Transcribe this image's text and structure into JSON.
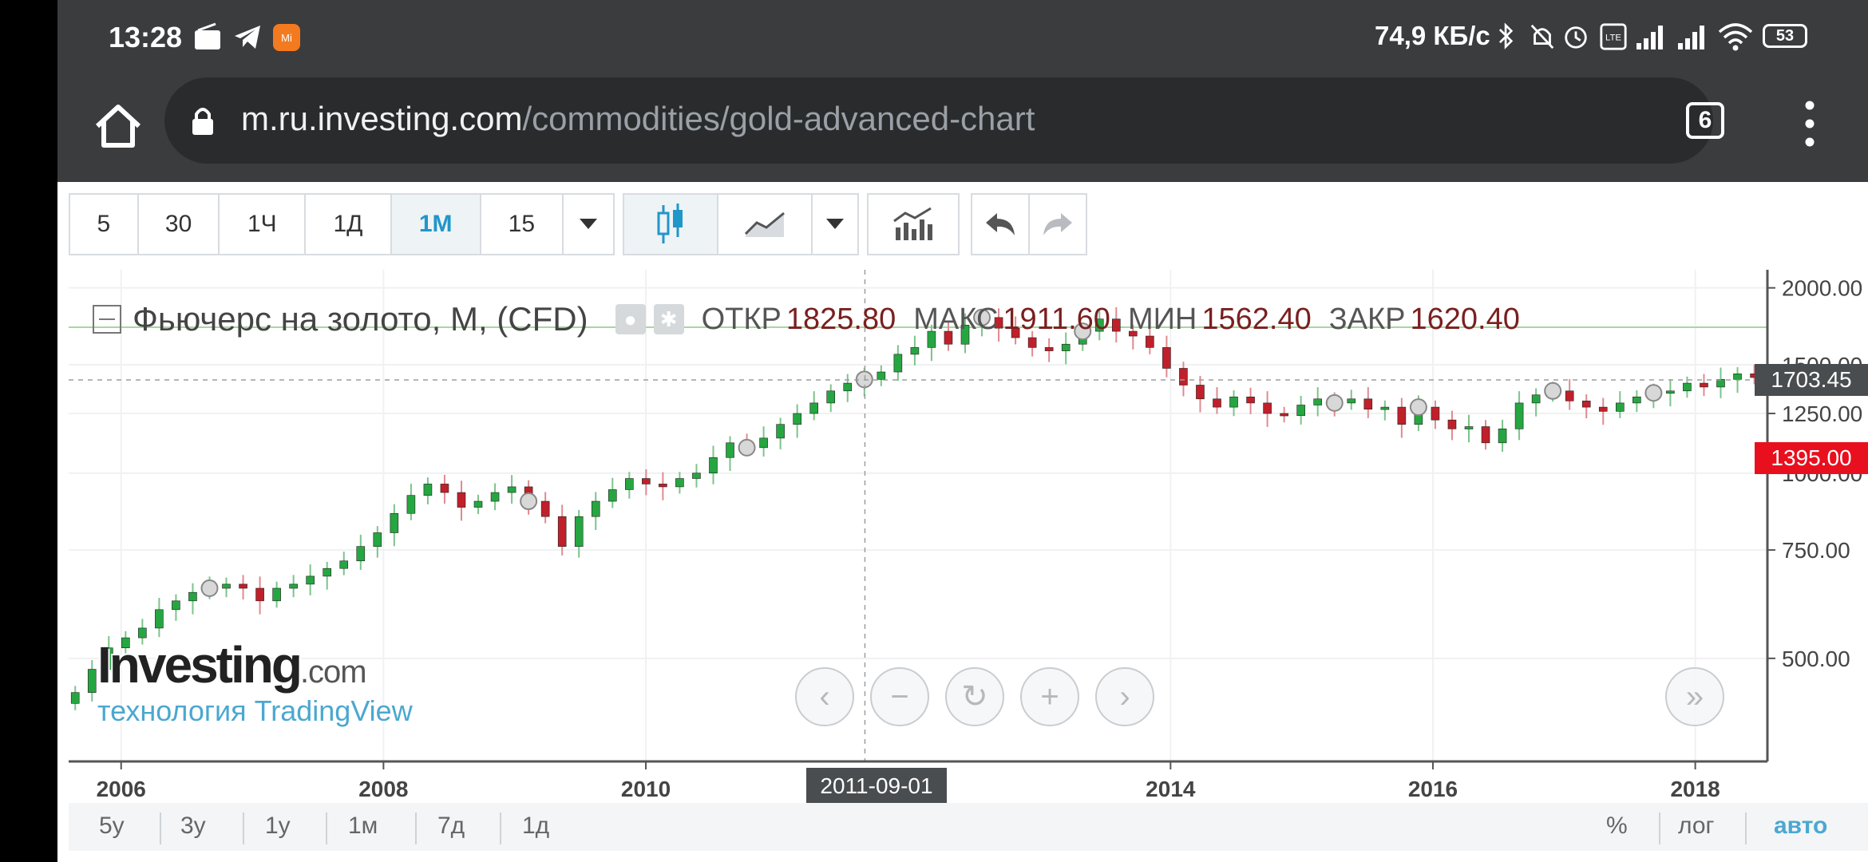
{
  "status": {
    "time": "13:28",
    "speed": "74,9 КБ/с",
    "battery": "53"
  },
  "browser": {
    "url_host": "m.ru.investing.com",
    "url_path": "/commodities/gold-advanced-chart",
    "tab_count": "6"
  },
  "toolbar": {
    "intervals": [
      "5",
      "30",
      "1Ч",
      "1Д",
      "1М",
      "15"
    ],
    "active_interval": "1М"
  },
  "legend": {
    "title": "Фьючерс на золото, M, (CFD)",
    "open_label": "ОТКР",
    "open_value": "1825.80",
    "high_label": "МАКС",
    "high_value": "1911.60",
    "low_label": "МИН",
    "low_value": "1562.40",
    "close_label": "ЗАКР",
    "close_value": "1620.40"
  },
  "watermark": {
    "logo": "Investing",
    "logo_suffix": ".com",
    "sub": "технология TradingView"
  },
  "crosshair": {
    "price_label": "1703.45",
    "date_label": "2011-09-01"
  },
  "last_price": "1395.00",
  "footer": {
    "ranges": [
      "5y",
      "3y",
      "1y",
      "1м",
      "7д",
      "1д"
    ],
    "percent": "%",
    "log": "лог",
    "auto": "авто"
  },
  "colors": {
    "up": "#26a641",
    "down": "#c0202a",
    "last_price_bg": "#e8101e",
    "crosshair_bg": "#4a4d50",
    "accent": "#4aa8d0"
  },
  "chart_data": {
    "type": "candlestick",
    "interval": "monthly",
    "y_ticks": [
      500,
      750,
      1000,
      1250,
      1500,
      2000
    ],
    "x_ticks": [
      "2006",
      "2008",
      "2010",
      "2014",
      "2016",
      "2018"
    ],
    "xlim": [
      2005.6,
      2018.55
    ],
    "ylim": [
      340,
      2140
    ],
    "series": [
      {
        "close": [
          440,
          480,
          520,
          540,
          560,
          600,
          620,
          640,
          650,
          660,
          650,
          620,
          650,
          660,
          680,
          700,
          720,
          760,
          800,
          860,
          920,
          960,
          930,
          880,
          900,
          930,
          950,
          900,
          850,
          760,
          850,
          900,
          940,
          980,
          960,
          950,
          980,
          1000,
          1060,
          1120,
          1100,
          1140,
          1200,
          1250,
          1300,
          1360,
          1400,
          1420,
          1460,
          1560,
          1600,
          1700,
          1620,
          1740,
          1790,
          1720,
          1660,
          1600,
          1580,
          1620,
          1700,
          1780,
          1700,
          1670,
          1600,
          1480,
          1390,
          1320,
          1280,
          1330,
          1300,
          1250,
          1240,
          1290,
          1320,
          1300,
          1320,
          1270,
          1280,
          1200,
          1280,
          1220,
          1180,
          1190,
          1120,
          1180,
          1300,
          1340,
          1360,
          1310,
          1280,
          1260,
          1300,
          1330,
          1350,
          1360,
          1400,
          1380,
          1420,
          1450,
          1430
        ]
      }
    ]
  }
}
